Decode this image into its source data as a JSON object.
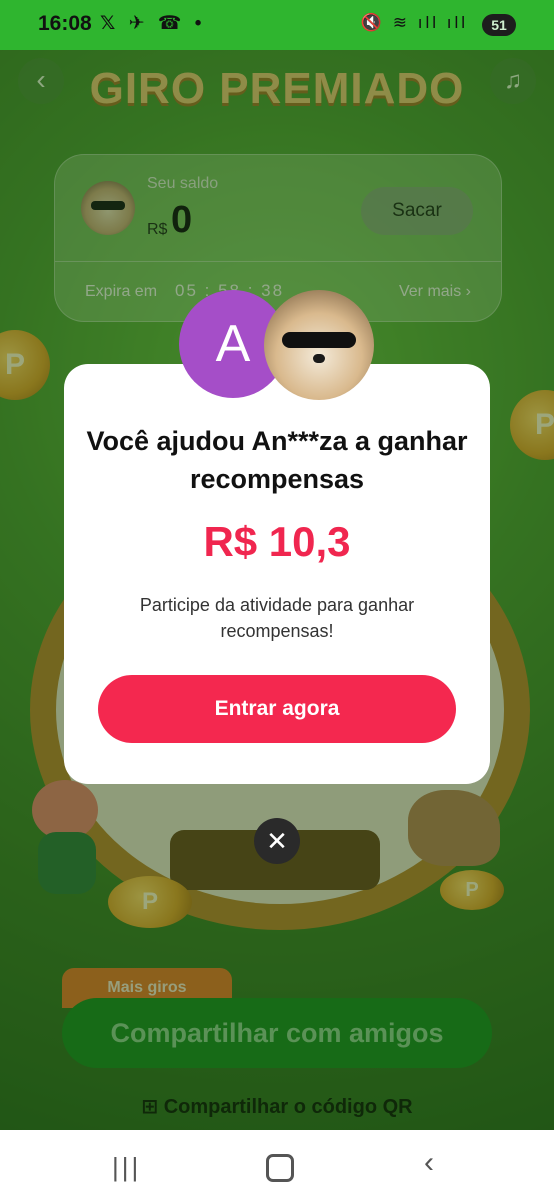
{
  "status_bar": {
    "time": "16:08",
    "left_icons": "𝕏 ✈ ☎ •",
    "right_icons": "🔇 ≋ ıll ıll",
    "battery": "51"
  },
  "game": {
    "title": "GIRO PREMIADO",
    "back_icon": "‹",
    "music_icon": "♫",
    "balance": {
      "label": "Seu saldo",
      "currency": "R$",
      "value": "0",
      "withdraw_label": "Sacar",
      "expires_label": "Expira em",
      "countdown": "05 : 58 : 38",
      "see_more": "Ver mais ›"
    },
    "coin_letter": "P",
    "more_spins": "Mais giros",
    "share_button": "Compartilhar com amigos",
    "qr_link": "Compartilhar o código QR"
  },
  "modal": {
    "avatar_letter": "A",
    "title": "Você ajudou An***za a ganhar recompensas",
    "amount": "R$ 10,3",
    "subtitle": "Participe da atividade para ganhar recompensas!",
    "cta": "Entrar agora",
    "close": "✕"
  },
  "nav": {
    "recent": "|||",
    "back": "‹"
  },
  "colors": {
    "accent": "#f4284f",
    "amount": "#f0264f",
    "status_bar": "#2fb52f",
    "avatar_purple": "#a54ec8"
  }
}
